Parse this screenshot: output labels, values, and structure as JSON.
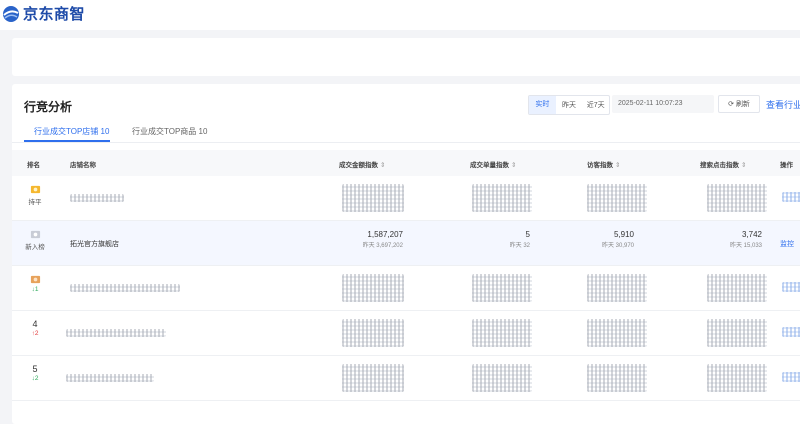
{
  "app": {
    "logo_text": "京东商智",
    "brand_color": "#1d4aa8"
  },
  "section": {
    "title": "行竞分析",
    "time_toggle": [
      "实时",
      "昨天",
      "近7天"
    ],
    "active_time": "实时",
    "datetime": "2025-02-11 10:07:23",
    "refresh_label": "刷新",
    "view_link": "查看行业"
  },
  "tabs": [
    {
      "label": "行业成交TOP店铺 10",
      "active": true
    },
    {
      "label": "行业成交TOP商品 10",
      "active": false
    }
  ],
  "table": {
    "headers": {
      "rank": "排名",
      "shop": "店铺名称",
      "gmv": "成交金额指数",
      "orders": "成交单量指数",
      "visitors": "访客指数",
      "search": "搜索点击指数",
      "op": "操作"
    },
    "rows": [
      {
        "rank_badge": "gold",
        "rank_text": "持平",
        "shop": "",
        "blurred": true
      },
      {
        "rank_badge": "silver",
        "rank_text": "新入榜",
        "shop": "拓光官方旗舰店",
        "blurred": false,
        "gmv": "1,587,207",
        "gmv_prev": "昨天 3,697,202",
        "orders": "5",
        "orders_prev": "昨天 32",
        "visitors": "5,910",
        "visitors_prev": "昨天 30,970",
        "search": "3,742",
        "search_prev": "昨天 15,033",
        "op": "监控"
      },
      {
        "rank_badge": "bronze",
        "rank_text": "↓1",
        "trend": "down",
        "shop": "",
        "blurred": true
      },
      {
        "rank_num": "4",
        "rank_text": "↑2",
        "trend": "up",
        "shop": "",
        "blurred": true
      },
      {
        "rank_num": "5",
        "rank_text": "↓2",
        "trend": "down",
        "shop": "",
        "blurred": true
      }
    ]
  },
  "colors": {
    "accent": "#2f6fed",
    "up": "#e23c3c",
    "down": "#2eaa5c"
  }
}
